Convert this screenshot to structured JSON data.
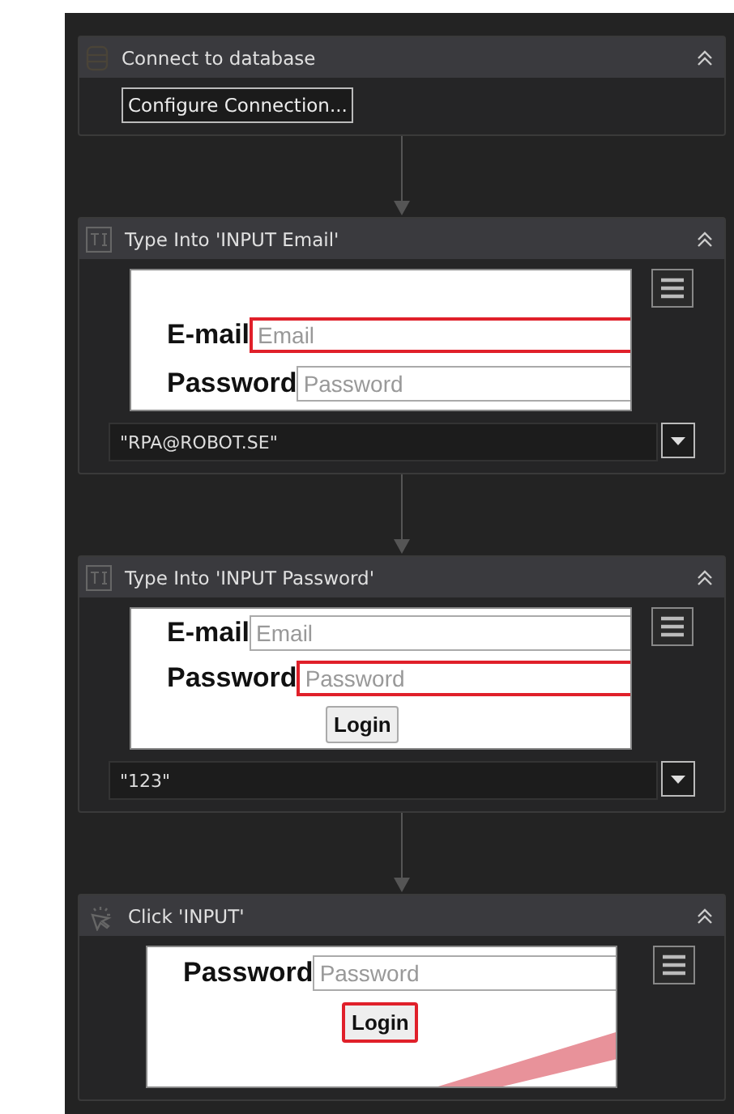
{
  "activities": [
    {
      "kind": "button",
      "title": "Connect to database",
      "action": "Configure Connection..."
    },
    {
      "kind": "type",
      "title": "Type Into 'INPUT  Email'",
      "preview": {
        "stripe": false,
        "rows": [
          {
            "kind": "field",
            "label": "E-mail",
            "placeholder": "Email",
            "highlighted": true
          },
          {
            "kind": "field",
            "label": "Password",
            "placeholder": "Password",
            "highlighted": false
          }
        ]
      },
      "value": "\"RPA@ROBOT.SE\""
    },
    {
      "kind": "type",
      "title": "Type Into 'INPUT  Password'",
      "preview": {
        "stripe": false,
        "rows": [
          {
            "kind": "field",
            "label": "E-mail",
            "placeholder": "Email",
            "highlighted": false
          },
          {
            "kind": "field",
            "label": "Password",
            "placeholder": "Password",
            "highlighted": true
          },
          {
            "kind": "button",
            "label": "Login",
            "highlighted": false
          }
        ]
      },
      "value": "\"123\""
    },
    {
      "kind": "click",
      "title": "Click 'INPUT'",
      "preview": {
        "stripe": true,
        "rows": [
          {
            "kind": "field",
            "label": "Password",
            "placeholder": "Password",
            "highlighted": false
          },
          {
            "kind": "button",
            "label": "Login",
            "highlighted": true
          }
        ]
      }
    }
  ]
}
